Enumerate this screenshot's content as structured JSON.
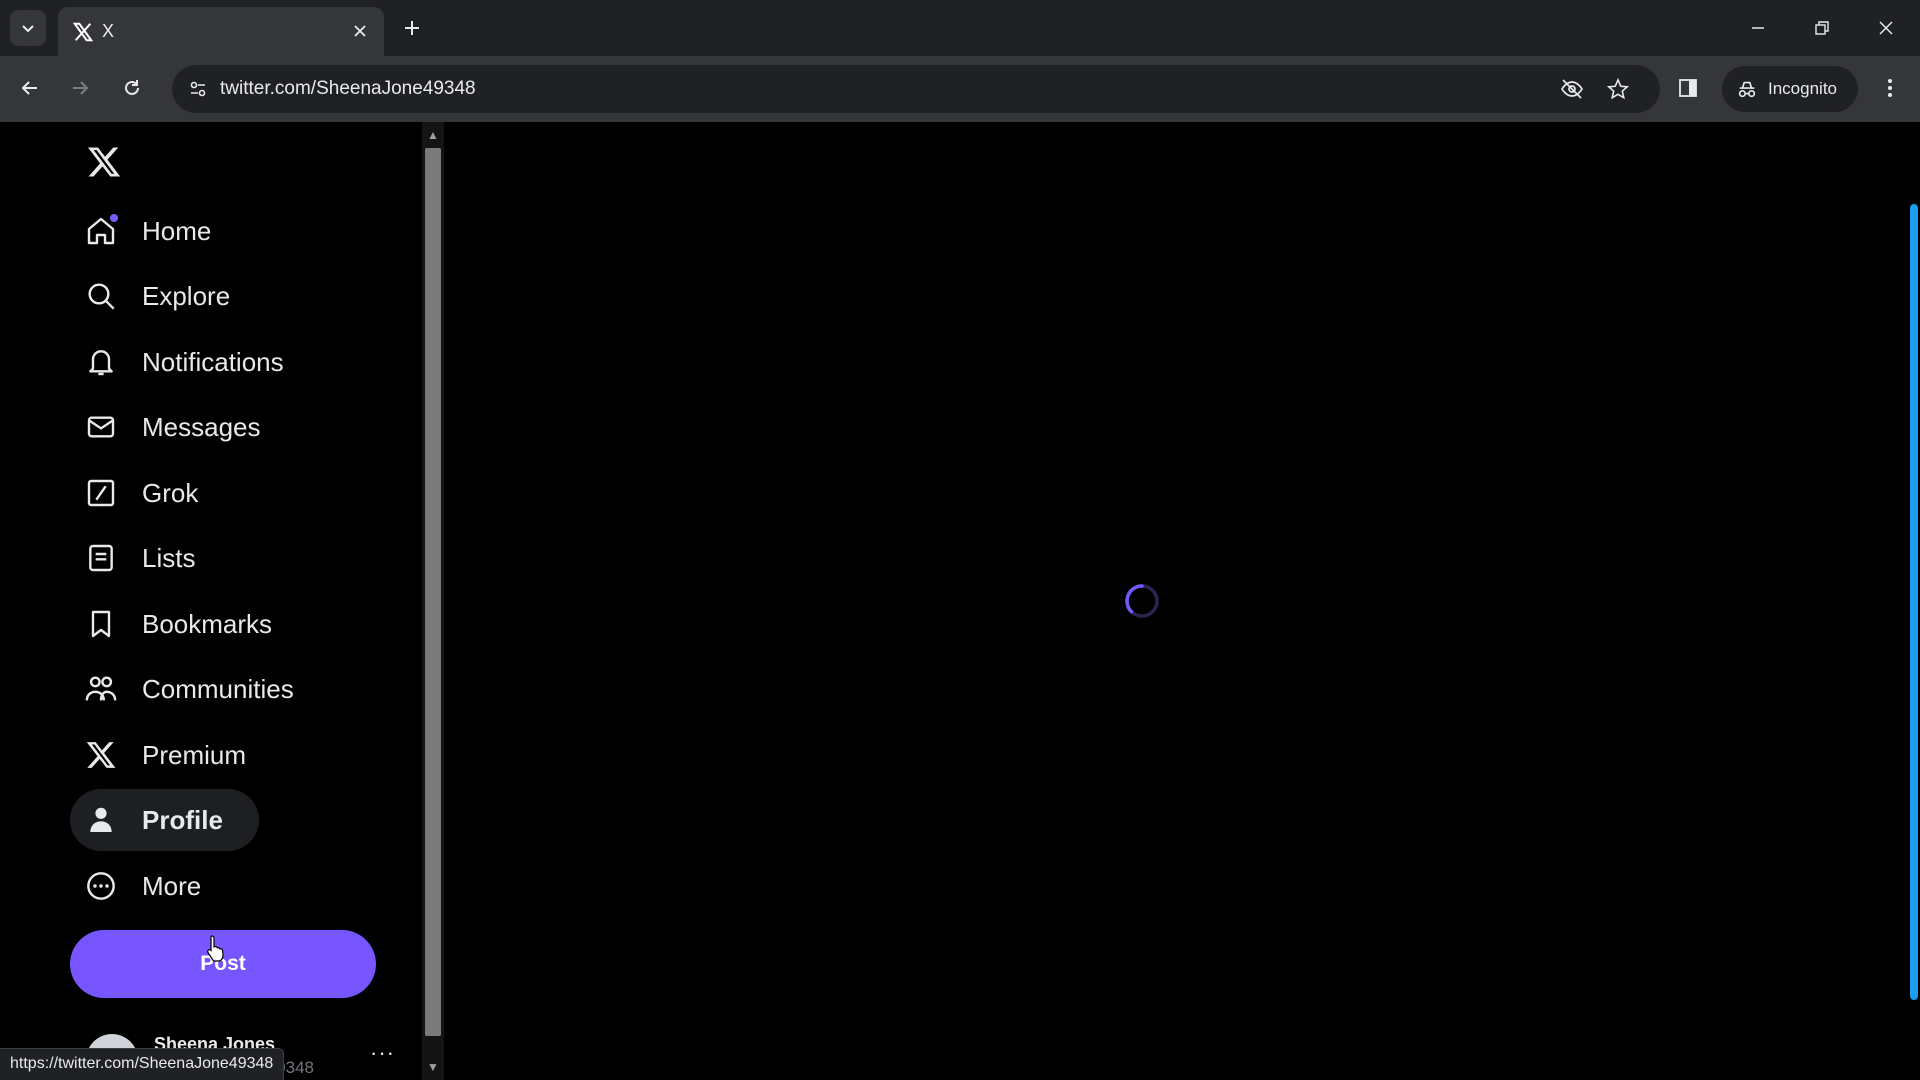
{
  "browser": {
    "tab_title": "X",
    "url": "twitter.com/SheenaJone49348",
    "incognito_label": "Incognito",
    "status_url": "https://twitter.com/SheenaJone49348"
  },
  "sidebar": {
    "logo": "x-logo-icon",
    "items": [
      {
        "label": "Home",
        "icon": "home-icon",
        "has_dot": true
      },
      {
        "label": "Explore",
        "icon": "search-icon"
      },
      {
        "label": "Notifications",
        "icon": "bell-icon"
      },
      {
        "label": "Messages",
        "icon": "mail-icon"
      },
      {
        "label": "Grok",
        "icon": "grok-icon"
      },
      {
        "label": "Lists",
        "icon": "list-icon"
      },
      {
        "label": "Bookmarks",
        "icon": "bookmark-icon"
      },
      {
        "label": "Communities",
        "icon": "communities-icon"
      },
      {
        "label": "Premium",
        "icon": "x-premium-icon"
      },
      {
        "label": "Profile",
        "icon": "person-icon",
        "active": true
      },
      {
        "label": "More",
        "icon": "more-circle-icon"
      }
    ],
    "post_label": "Post",
    "account": {
      "name": "Sheena Jones",
      "handle": "@SheenaJone49348",
      "more": "···"
    }
  },
  "colors": {
    "accent": "#7856ff",
    "background": "#000000",
    "text": "#e7e9ea",
    "muted": "#71767b",
    "chrome": "#35363a",
    "chrome_dark": "#202124"
  }
}
